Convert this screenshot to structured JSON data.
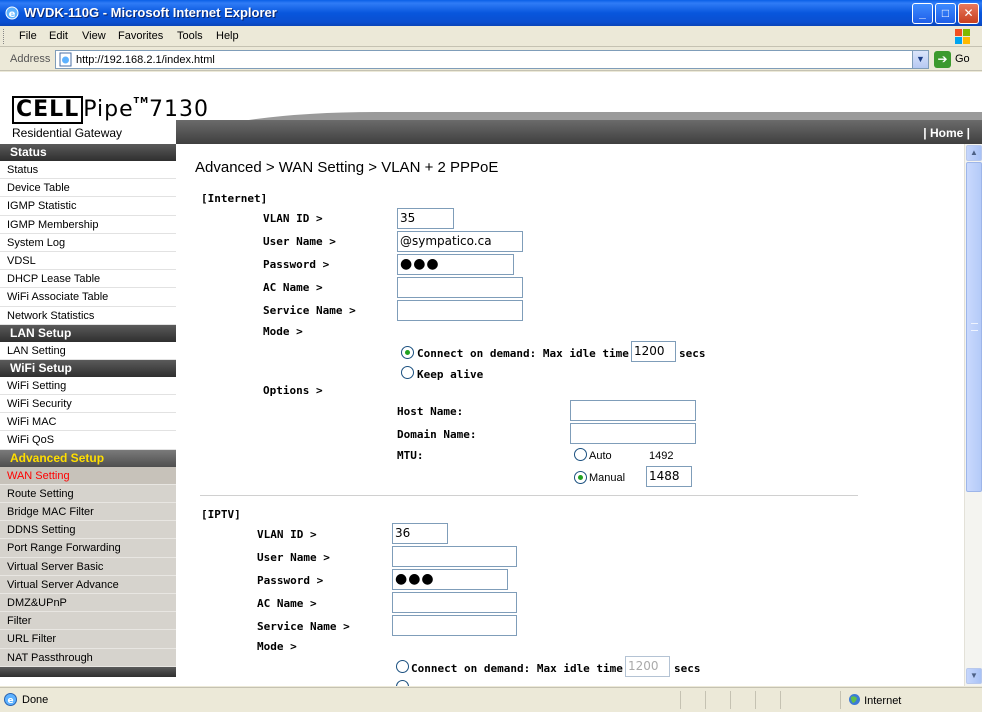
{
  "window": {
    "title": "WVDK-110G - Microsoft Internet Explorer",
    "controls": {
      "minimize": "_",
      "maximize": "□",
      "close": "✕"
    }
  },
  "menu": [
    "File",
    "Edit",
    "View",
    "Favorites",
    "Tools",
    "Help"
  ],
  "address": {
    "label": "Address",
    "url": "http://192.168.2.1/index.html",
    "go_label": "Go"
  },
  "header": {
    "logo_cell": "CELL",
    "logo_pipe": "Pipe",
    "logo_tm": "TM",
    "logo_model": "7130",
    "logo_subtitle": "Residential Gateway",
    "home_link": "| Home |"
  },
  "sidebar": {
    "sections": [
      {
        "title": "Status",
        "items": [
          "Status",
          "Device Table",
          "IGMP Statistic",
          "IGMP Membership",
          "System Log",
          "VDSL",
          "DHCP Lease Table",
          "WiFi Associate Table",
          "Network Statistics"
        ]
      },
      {
        "title": "LAN Setup",
        "items": [
          "LAN Setting"
        ]
      },
      {
        "title": "WiFi Setup",
        "items": [
          "WiFi Setting",
          "WiFi Security",
          "WiFi MAC",
          "WiFi QoS"
        ]
      },
      {
        "title": "Advanced Setup",
        "items": [
          "WAN Setting",
          "Route Setting",
          "Bridge MAC Filter",
          "DDNS Setting",
          "Port Range Forwarding",
          "Virtual Server Basic",
          "Virtual Server Advance",
          "DMZ&UPnP",
          "Filter",
          "URL Filter",
          "NAT Passthrough"
        ]
      }
    ],
    "active_item": "WAN Setting"
  },
  "main": {
    "page_title": "Advanced > WAN Setting > VLAN + 2 PPPoE",
    "internet": {
      "section_title": "[Internet]",
      "vlan_id_label": "VLAN ID >",
      "vlan_id": "35",
      "user_name_label": "User Name >",
      "user_name": "@sympatico.ca",
      "password_label": "Password >",
      "password": "●●●",
      "ac_name_label": "AC Name >",
      "ac_name": "",
      "service_name_label": "Service Name >",
      "service_name": "",
      "mode_label": "Mode >",
      "connect_on_demand_label": "Connect on demand: Max idle time",
      "max_idle_time": "1200",
      "secs_label": "secs",
      "keep_alive_label": "Keep alive",
      "options_label": "Options >",
      "host_name_label": "Host Name:",
      "host_name": "",
      "domain_name_label": "Domain Name:",
      "domain_name": "",
      "mtu_label": "MTU:",
      "mtu_auto_label": "Auto",
      "mtu_auto_value": "1492",
      "mtu_manual_label": "Manual",
      "mtu_manual_value": "1488"
    },
    "iptv": {
      "section_title": "[IPTV]",
      "vlan_id_label": "VLAN ID >",
      "vlan_id": "36",
      "user_name_label": "User Name >",
      "user_name": "",
      "password_label": "Password >",
      "password": "●●●",
      "ac_name_label": "AC Name >",
      "ac_name": "",
      "service_name_label": "Service Name >",
      "service_name": "",
      "mode_label": "Mode >",
      "connect_on_demand_label": "Connect on demand: Max idle time",
      "max_idle_time": "1200",
      "secs_label": "secs"
    }
  },
  "status": {
    "text": "Done",
    "zone": "Internet"
  }
}
